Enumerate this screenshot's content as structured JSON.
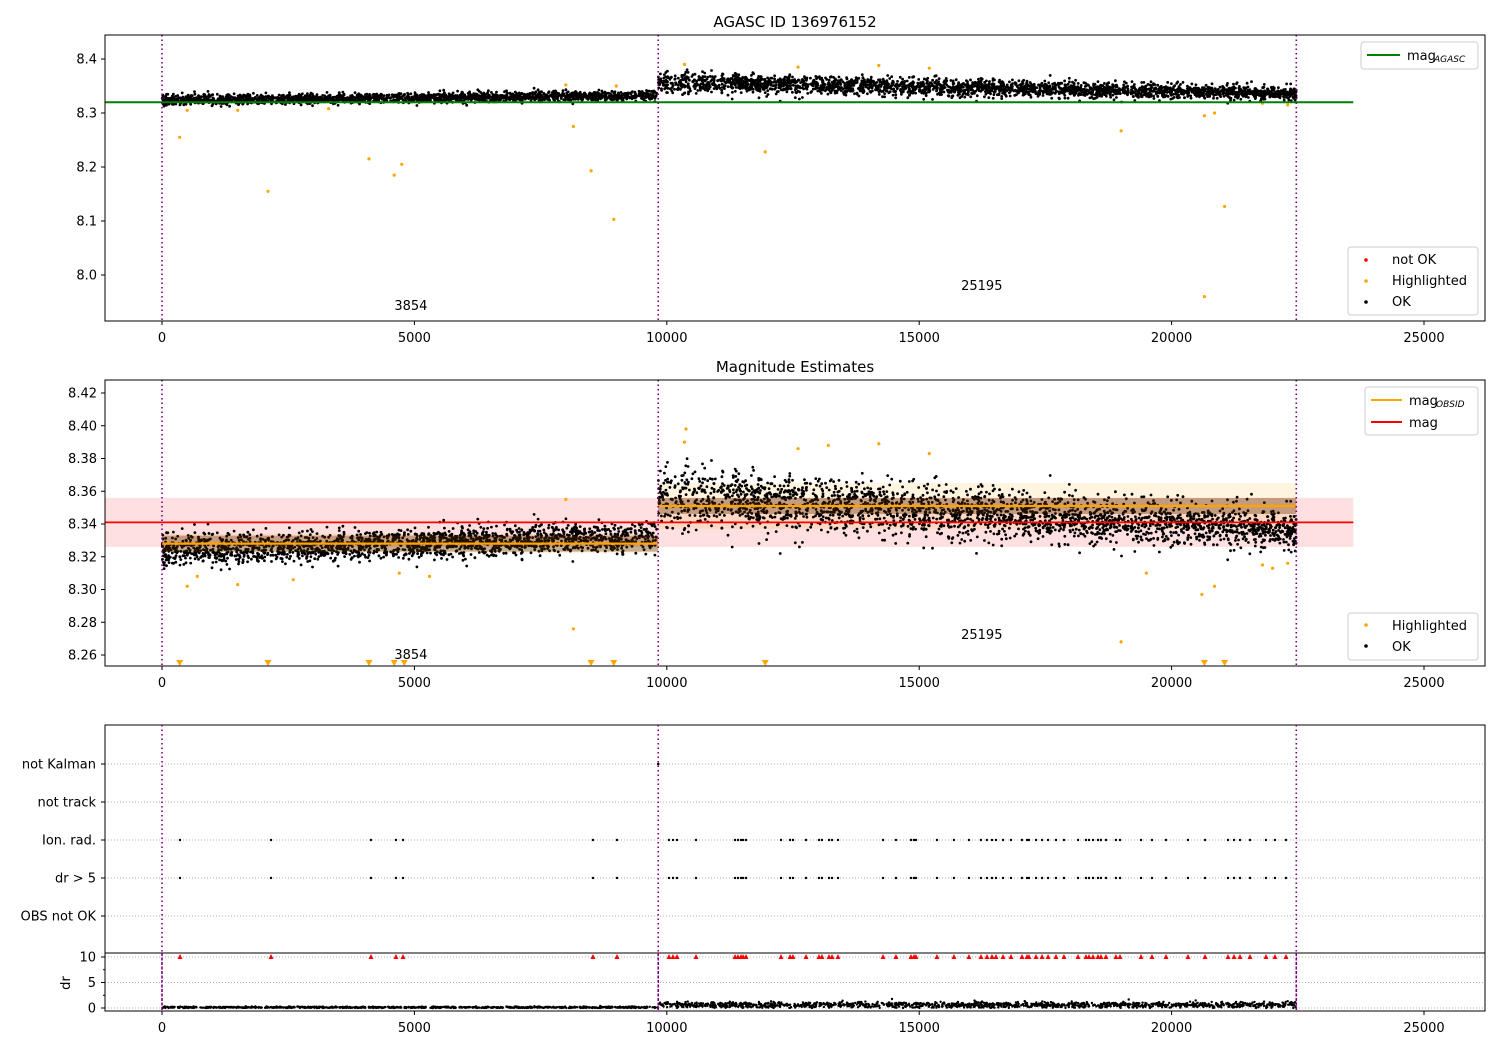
{
  "chart_data": [
    {
      "type": "scatter",
      "title": "AGASC ID 136976152",
      "xlim": [
        -1130,
        26210
      ],
      "ylim": [
        7.915,
        8.444
      ],
      "xticks": [
        "0",
        "5000",
        "10000",
        "15000",
        "20000",
        "25000"
      ],
      "yticks": [
        "8.0",
        "8.1",
        "8.2",
        "8.3",
        "8.4"
      ],
      "vlines": [
        0,
        9830,
        22470
      ],
      "mag_agasc": 8.32,
      "legend_lines": [
        {
          "label": "mag",
          "sub": "AGASC",
          "color": "#008000"
        }
      ],
      "legend_points": [
        {
          "label": "not OK",
          "color": "#ff0000"
        },
        {
          "label": "Highlighted",
          "color": "#ffa500"
        },
        {
          "label": "OK",
          "color": "#000000"
        }
      ],
      "annotations": [
        {
          "text": "3854",
          "x": 4930,
          "y": 7.935
        },
        {
          "text": "25195",
          "x": 16240,
          "y": 7.972
        }
      ],
      "segments": [
        {
          "x": [
            0,
            9830
          ],
          "mean": [
            8.324,
            8.332
          ],
          "sd": 0.0045
        },
        {
          "x": [
            9830,
            22470
          ],
          "mean": [
            8.357,
            8.336
          ],
          "sd": 0.0085
        }
      ],
      "highlighted": [
        [
          350,
          8.255
        ],
        [
          2100,
          8.155
        ],
        [
          4100,
          8.215
        ],
        [
          4600,
          8.185
        ],
        [
          4750,
          8.205
        ],
        [
          8150,
          8.275
        ],
        [
          8500,
          8.193
        ],
        [
          8950,
          8.103
        ],
        [
          11950,
          8.228
        ],
        [
          19000,
          8.267
        ],
        [
          20650,
          7.96
        ],
        [
          21050,
          8.127
        ],
        [
          20650,
          8.295
        ],
        [
          20850,
          8.3
        ],
        [
          10350,
          8.39
        ],
        [
          12600,
          8.385
        ],
        [
          14200,
          8.388
        ],
        [
          15200,
          8.383
        ],
        [
          8000,
          8.352
        ],
        [
          9000,
          8.35
        ],
        [
          500,
          8.305
        ],
        [
          1500,
          8.305
        ],
        [
          3300,
          8.308
        ],
        [
          21800,
          8.318
        ],
        [
          22300,
          8.315
        ]
      ]
    },
    {
      "type": "scatter",
      "title": "Magnitude Estimates",
      "xlim": [
        -1130,
        26210
      ],
      "ylim": [
        8.2533,
        8.428
      ],
      "xticks": [
        "0",
        "5000",
        "10000",
        "15000",
        "20000",
        "25000"
      ],
      "yticks": [
        "8.26",
        "8.28",
        "8.30",
        "8.32",
        "8.34",
        "8.36",
        "8.38",
        "8.40",
        "8.42"
      ],
      "vlines": [
        0,
        9830,
        22470
      ],
      "mag": 8.341,
      "mag_band": [
        8.326,
        8.356
      ],
      "mag_obsid": [
        {
          "x": [
            0,
            9830
          ],
          "value": 8.328,
          "band": [
            8.322,
            8.334
          ]
        },
        {
          "x": [
            9830,
            22470
          ],
          "value": 8.351,
          "band": [
            8.337,
            8.365
          ]
        }
      ],
      "legend_lines": [
        {
          "label": "mag",
          "sub": "OBSID",
          "color": "#ffa500"
        },
        {
          "label": "mag",
          "sub": "",
          "color": "#ff0000"
        }
      ],
      "legend_points": [
        {
          "label": "Highlighted",
          "color": "#ffa500"
        },
        {
          "label": "OK",
          "color": "#000000"
        }
      ],
      "annotations": [
        {
          "text": "3854",
          "x": 4930,
          "y": 8.2575
        },
        {
          "text": "25195",
          "x": 16240,
          "y": 8.2697
        }
      ],
      "highlighted": [
        [
          8150,
          8.276
        ],
        [
          19000,
          8.268
        ],
        [
          20600,
          8.297
        ],
        [
          20850,
          8.302
        ],
        [
          10350,
          8.39
        ],
        [
          10380,
          8.398
        ],
        [
          12600,
          8.386
        ],
        [
          13200,
          8.388
        ],
        [
          14200,
          8.389
        ],
        [
          15200,
          8.383
        ],
        [
          8000,
          8.355
        ],
        [
          500,
          8.302
        ],
        [
          1500,
          8.303
        ],
        [
          700,
          8.308
        ],
        [
          2600,
          8.306
        ],
        [
          4700,
          8.31
        ],
        [
          5300,
          8.308
        ],
        [
          19500,
          8.31
        ],
        [
          21800,
          8.315
        ],
        [
          22000,
          8.313
        ],
        [
          22300,
          8.316
        ]
      ],
      "below_axis": [
        350,
        2100,
        4100,
        4600,
        4800,
        8500,
        8950,
        11950,
        20650,
        21050
      ]
    },
    {
      "type": "scatter",
      "title": "",
      "xlim": [
        -1130,
        26210
      ],
      "xticks": [
        "0",
        "5000",
        "10000",
        "15000",
        "20000",
        "25000"
      ],
      "categories": [
        "not Kalman",
        "not track",
        "Ion. rad.",
        "dr > 5",
        "OBS not OK"
      ],
      "vlines": [
        0,
        9830,
        22470
      ],
      "not_kalman": [
        9830
      ],
      "flag_x": [
        357,
        2159,
        4140,
        4635,
        4774,
        8538,
        9014,
        10044,
        10123,
        10202,
        10579,
        11351,
        11410,
        11470,
        11510,
        11569,
        12262,
        12441,
        12500,
        12758,
        13015,
        13074,
        13213,
        13273,
        13391,
        14283,
        14540,
        14837,
        14897,
        14936,
        15352,
        15689,
        15986,
        16224,
        16343,
        16442,
        16521,
        16660,
        16819,
        17036,
        17136,
        17175,
        17314,
        17433,
        17552,
        17710,
        17868,
        18146,
        18304,
        18364,
        18443,
        18542,
        18601,
        18700,
        18898,
        18978,
        19394,
        19612,
        19889,
        20325,
        20662,
        21117,
        21236,
        21355,
        21553,
        21870,
        22048,
        22266
      ],
      "dr_ylabel": "dr",
      "dr_yticks": [
        "0",
        "5",
        "10"
      ],
      "dr_clip": 10,
      "dr_segments": [
        {
          "x": [
            0,
            9830
          ],
          "mean": 0.12,
          "sd": 0.08
        },
        {
          "x": [
            9830,
            22470
          ],
          "mean": 0.6,
          "sd": 0.3
        }
      ]
    }
  ]
}
